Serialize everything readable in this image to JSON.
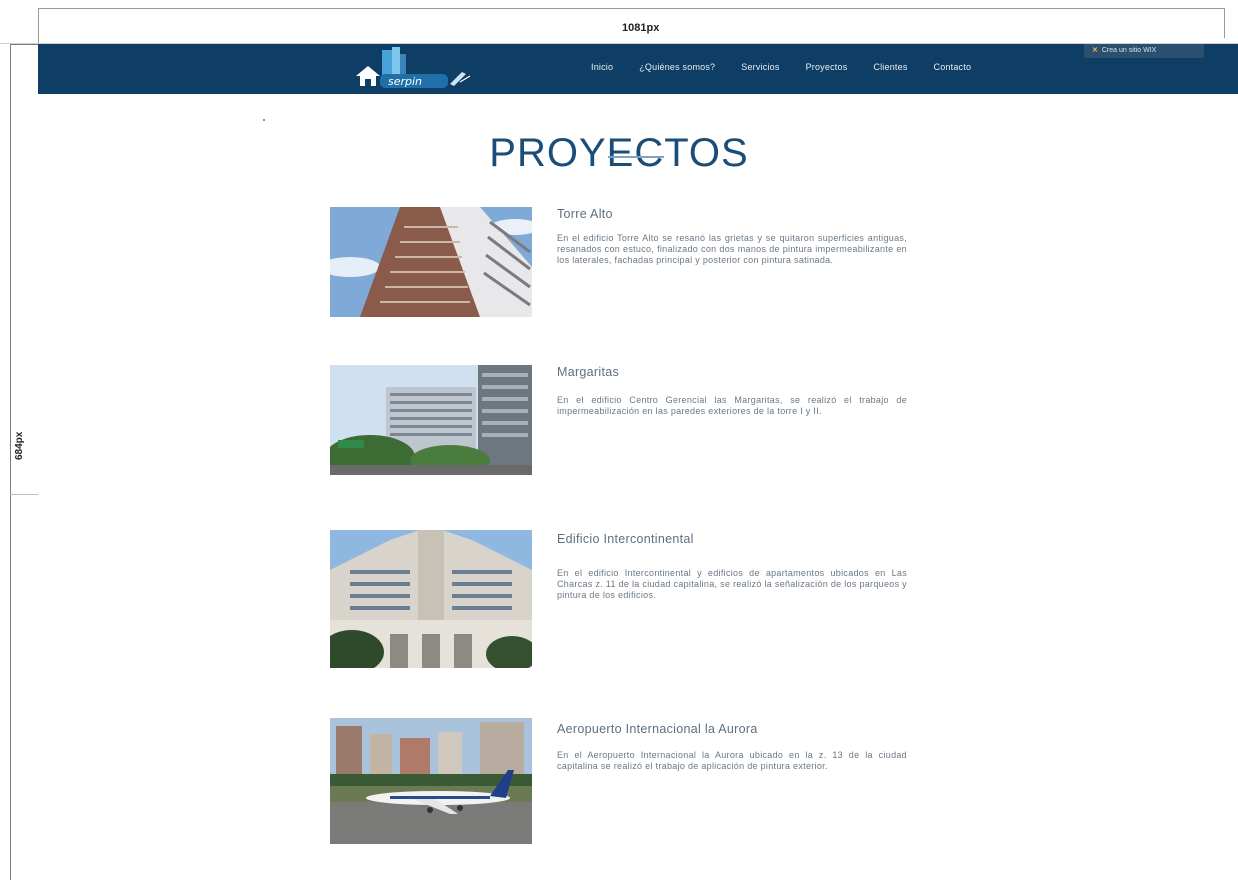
{
  "spec": {
    "width_label": "1081px",
    "height_label": "684px"
  },
  "header": {
    "logo_text": "serpin",
    "nav": [
      "Inicio",
      "¿Quiénes somos?",
      "Servicios",
      "Proyectos",
      "Clientes",
      "Contacto"
    ],
    "wix_button": "Crea un sitio WIX",
    "colors": {
      "bar": "#0e3e66",
      "accent": "#7ea3c4"
    }
  },
  "page": {
    "title": "PROYECTOS"
  },
  "projects": [
    {
      "title": "Torre Alto",
      "description": "En el edificio Torre Alto se resanó las grietas y se quitaron superficies antiguas, resanados con estuco, finalizado con dos manos de pintura impermeabilizante en los laterales, fachadas principal y posterior con pintura satinada."
    },
    {
      "title": "Margaritas",
      "description": "En el edificio Centro Gerencial las Margaritas, se realizó el trabajo de impermeabilización en las paredes exteriores de la torre I y II."
    },
    {
      "title": "Edificio Intercontinental",
      "description": "En el edificio Intercontinental y edificios de apartamentos ubicados en Las Charcas z. 11 de la ciudad capitalina, se realizó la señalización de los parqueos y pintura de los edificios."
    },
    {
      "title": "Aeropuerto Internacional la Aurora",
      "description": "En el Aeropuerto Internacional la Aurora ubicado en la z. 13 de la ciudad capitalina se realizó el trabajo de aplicación de pintura exterior."
    }
  ]
}
